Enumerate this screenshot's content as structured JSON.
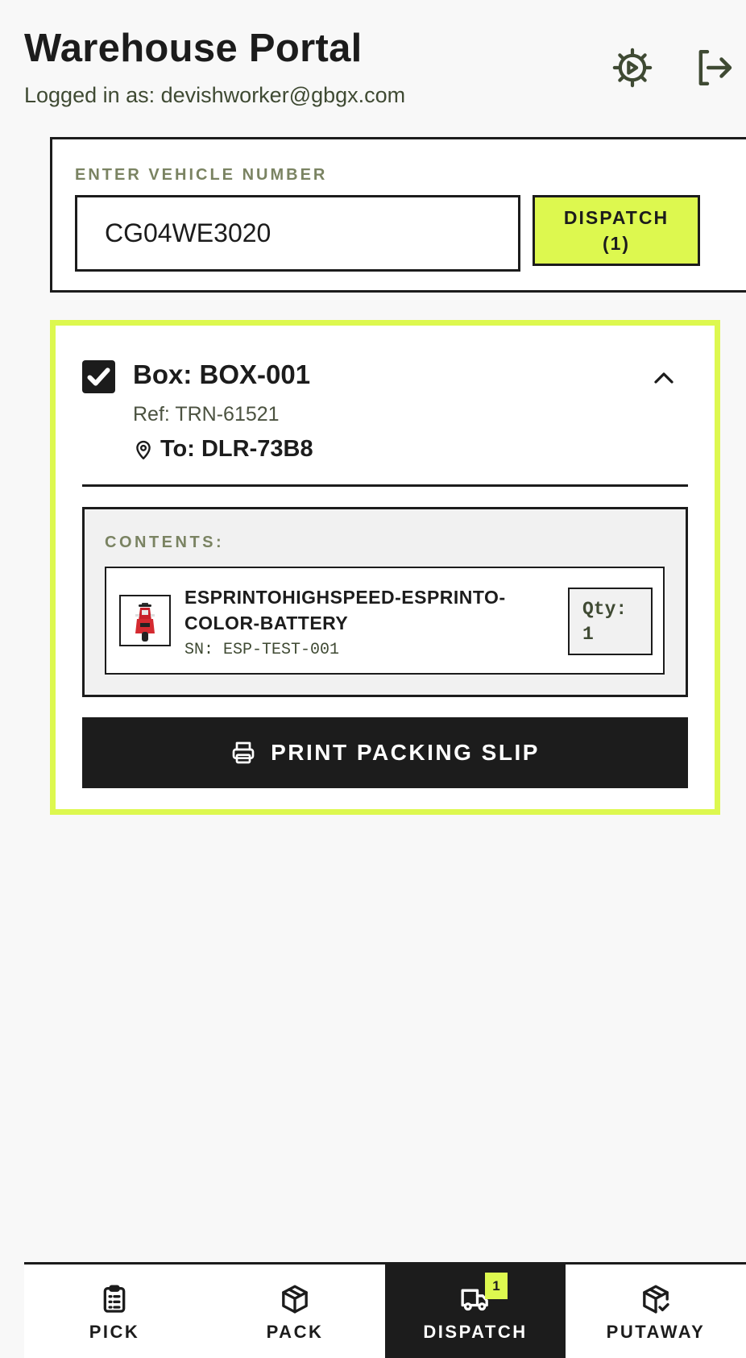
{
  "header": {
    "title": "Warehouse Portal",
    "logged_in": "Logged in as: devishworker@gbgx.com",
    "settings_icon": "gear-icon",
    "logout_icon": "logout-icon"
  },
  "vehicle": {
    "label": "ENTER VEHICLE NUMBER",
    "value": "CG04WE3020",
    "dispatch_label": "DISPATCH\n(1)"
  },
  "box": {
    "checked": true,
    "title": "Box: BOX-001",
    "ref": "Ref: TRN-61521",
    "destination": "To: DLR-73B8",
    "contents_label": "CONTENTS:",
    "items": [
      {
        "name": "ESPRINTOHIGHSPEED-ESPRINTO-COLOR-BATTERY",
        "sn": "SN: ESP-TEST-001",
        "qty": "Qty:\n1",
        "thumb": "scooter-image"
      }
    ],
    "print_label": "PRINT PACKING SLIP"
  },
  "nav": {
    "tabs": [
      {
        "label": "PICK",
        "icon": "clipboard-icon",
        "active": false
      },
      {
        "label": "PACK",
        "icon": "box-icon",
        "active": false
      },
      {
        "label": "DISPATCH",
        "icon": "truck-icon",
        "active": true,
        "badge": "1"
      },
      {
        "label": "PUTAWAY",
        "icon": "package-check-icon",
        "active": false
      }
    ]
  },
  "colors": {
    "accent": "#ddf84f",
    "dark": "#1c1c1c",
    "muted_label": "#7a8362",
    "background": "#f8f8f8"
  }
}
